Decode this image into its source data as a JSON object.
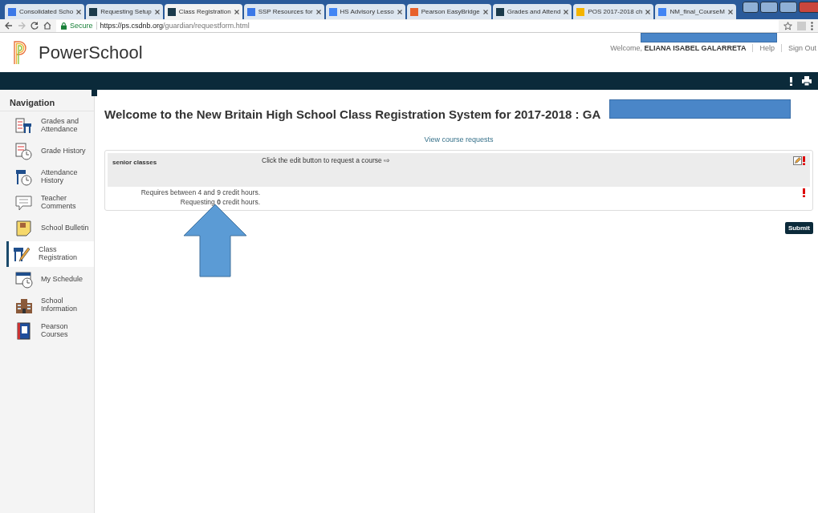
{
  "browser": {
    "tabs": [
      {
        "title": "Consolidated Scho",
        "selected": false
      },
      {
        "title": "Requesting Setup",
        "selected": false
      },
      {
        "title": "Class Registration",
        "selected": true
      },
      {
        "title": "SSP Resources for",
        "selected": false
      },
      {
        "title": "HS Advisory Lesso",
        "selected": false
      },
      {
        "title": "Pearson EasyBridge",
        "selected": false
      },
      {
        "title": "Grades and Attend",
        "selected": false
      },
      {
        "title": "POS 2017-2018 ch",
        "selected": false
      },
      {
        "title": "NM_final_CourseM",
        "selected": false
      }
    ],
    "secure_label": "Secure",
    "url_host": "https://ps.csdnb.org",
    "url_path": "/guardian/requestform.html"
  },
  "header": {
    "logo": "PowerSchool",
    "welcome": "Welcome,",
    "user": "ELIANA ISABEL GALARRETA",
    "links": [
      "Help",
      "Sign Out"
    ]
  },
  "sidebar": {
    "title": "Navigation",
    "items": [
      {
        "label": "Grades and Attendance",
        "selected": false
      },
      {
        "label": "Grade History",
        "selected": false
      },
      {
        "label": "Attendance History",
        "selected": false
      },
      {
        "label": "Teacher Comments",
        "selected": false
      },
      {
        "label": "School Bulletin",
        "selected": false
      },
      {
        "label": "Class Registration",
        "selected": true
      },
      {
        "label": "My Schedule",
        "selected": false
      },
      {
        "label": "School Information",
        "selected": false
      },
      {
        "label": "Pearson Courses",
        "selected": false
      }
    ]
  },
  "main": {
    "title": "Welcome to the New Britain High School Class Registration System for 2017-2018 : GA",
    "view_link": "View course requests",
    "group": {
      "name": "senior classes",
      "instruction": "Click the edit button to request a course ⇨",
      "requires": "Requires between 4 and 9 credit hours.",
      "requesting": "Requesting **0** credit hours."
    },
    "submit": "Submit"
  }
}
